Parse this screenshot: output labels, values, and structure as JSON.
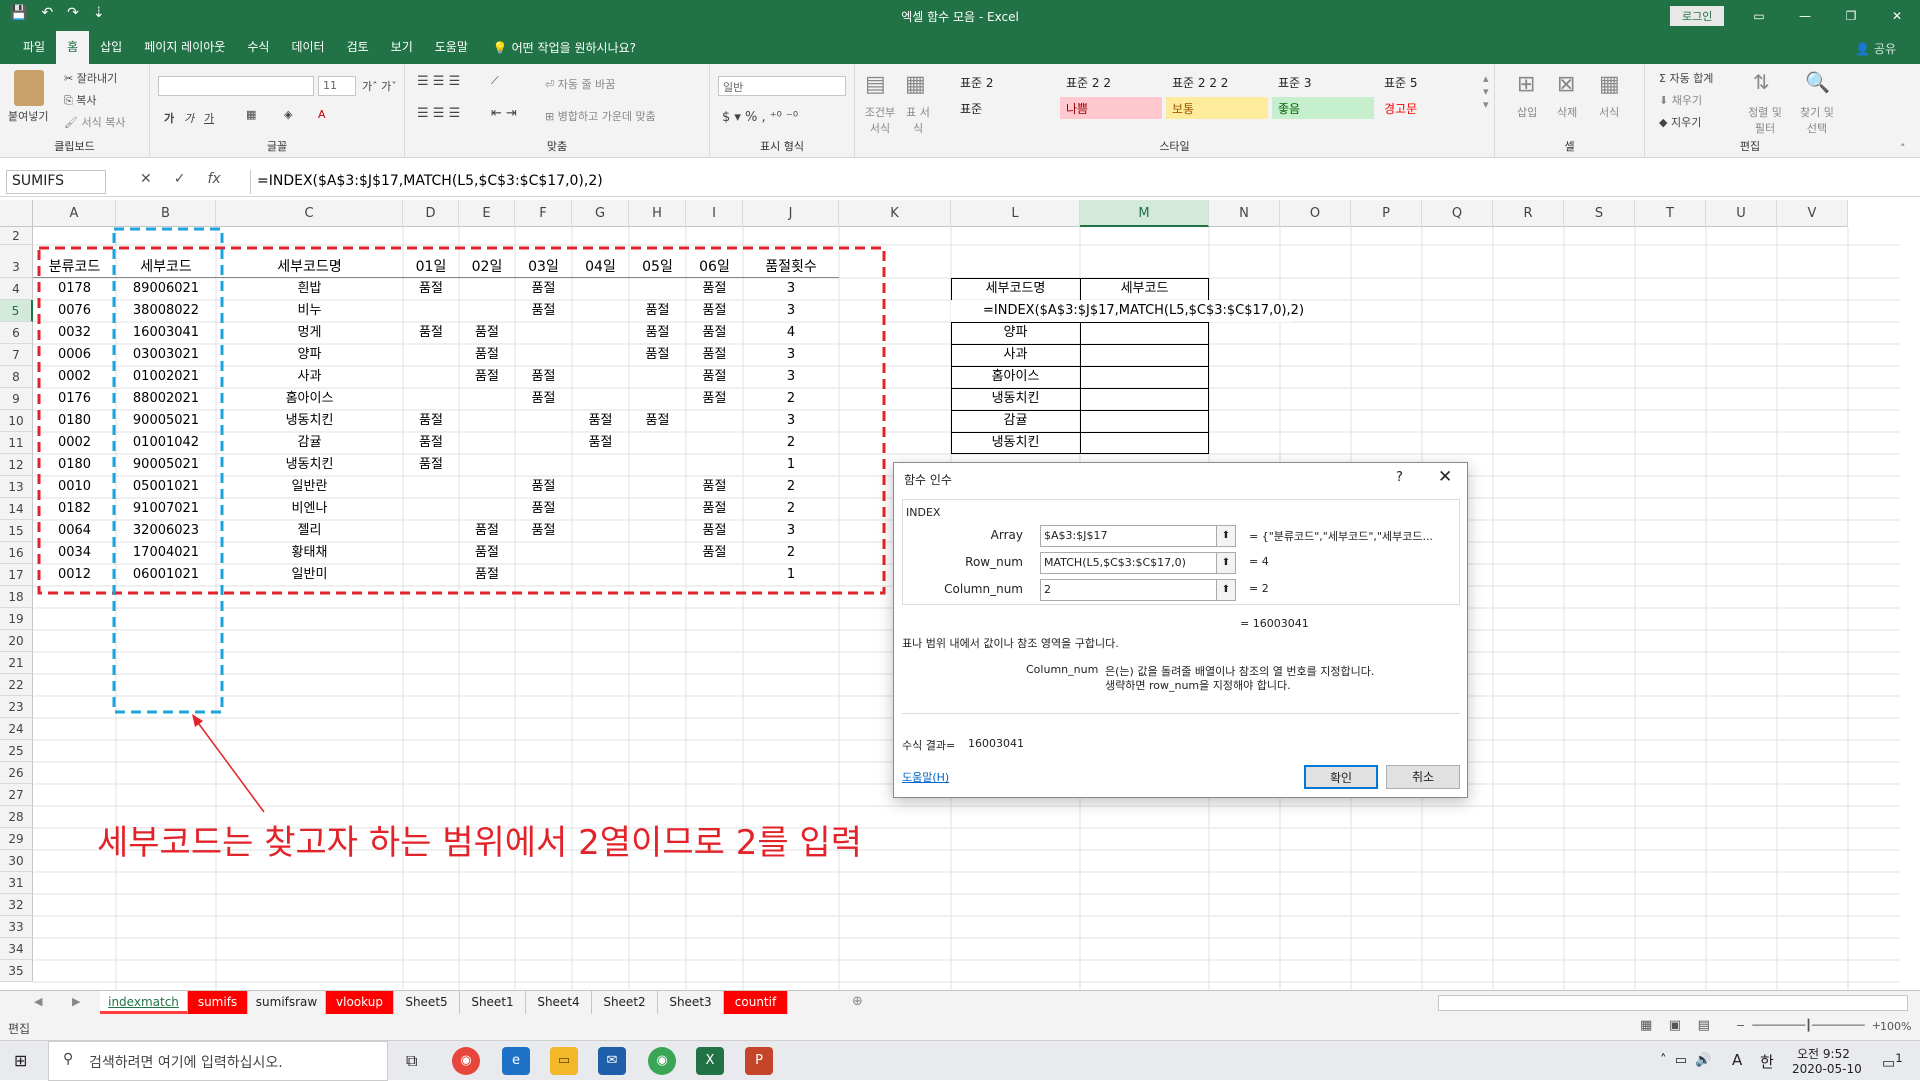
{
  "window": {
    "title": "엑셀 함수 모음  -  Excel",
    "login": "로그인",
    "qat": [
      "💾",
      "↶",
      "↷",
      "⇣"
    ]
  },
  "menu": {
    "tabs": [
      "파일",
      "홈",
      "삽입",
      "페이지 레이아웃",
      "수식",
      "데이터",
      "검토",
      "보기",
      "도움말"
    ],
    "search": "어떤 작업을 원하시나요?",
    "share": "공유"
  },
  "ribbon": {
    "clipboard": {
      "label": "클립보드",
      "paste": "붙여넣기",
      "cut": "잘라내기",
      "copy": "복사",
      "format_painter": "서식 복사"
    },
    "font": {
      "label": "글꼴",
      "size": "11",
      "bold": "가",
      "italic": "가",
      "underline": "가"
    },
    "align": {
      "label": "맞춤",
      "wrap": "자동 줄 바꿈",
      "merge": "병합하고 가운데 맞춤"
    },
    "number": {
      "label": "표시 형식",
      "format": "일반"
    },
    "styles": {
      "label": "스타일",
      "cond": "조건부 서식",
      "table": "표 서식",
      "cells": [
        {
          "text": "표준 2",
          "bg": "#ffffff",
          "color": "#222"
        },
        {
          "text": "표준 2 2",
          "bg": "#ffffff",
          "color": "#222"
        },
        {
          "text": "표준 2 2 2",
          "bg": "#ffffff",
          "color": "#222"
        },
        {
          "text": "표준 3",
          "bg": "#ffffff",
          "color": "#222"
        },
        {
          "text": "표준 5",
          "bg": "#ffffff",
          "color": "#222"
        },
        {
          "text": "표준",
          "bg": "#ffffff",
          "color": "#222"
        },
        {
          "text": "나쁨",
          "bg": "#ffc7ce",
          "color": "#9c0006"
        },
        {
          "text": "보통",
          "bg": "#ffeb9c",
          "color": "#9c5700"
        },
        {
          "text": "좋음",
          "bg": "#c6efce",
          "color": "#006100"
        },
        {
          "text": "경고문",
          "bg": "#ffffff",
          "color": "#ff0000"
        }
      ]
    },
    "cells": {
      "label": "셀",
      "insert": "삽입",
      "delete": "삭제",
      "format": "서식"
    },
    "editing": {
      "label": "편집",
      "autosum": "자동 합계",
      "fill": "채우기",
      "clear": "지우기",
      "sort": "정렬 및 필터",
      "find": "찾기 및 선택"
    }
  },
  "formula_bar": {
    "name_box": "SUMIFS",
    "formula": "=INDEX($A$3:$J$17,MATCH(L5,$C$3:$C$17,0),2)"
  },
  "columns": [
    "A",
    "B",
    "C",
    "D",
    "E",
    "F",
    "G",
    "H",
    "I",
    "J",
    "K",
    "L",
    "M",
    "N",
    "O",
    "P",
    "Q",
    "R",
    "S",
    "T",
    "U",
    "V"
  ],
  "rows": [
    "2",
    "3",
    "4",
    "5",
    "6",
    "7",
    "8",
    "9",
    "10",
    "11",
    "12",
    "13",
    "14",
    "15",
    "16",
    "17",
    "18",
    "19",
    "20",
    "21",
    "22",
    "23",
    "24",
    "25",
    "26",
    "27",
    "28",
    "29",
    "30",
    "31",
    "32",
    "33",
    "34",
    "35"
  ],
  "table": {
    "headers": [
      "분류코드",
      "세부코드",
      "세부코드명",
      "01일",
      "02일",
      "03일",
      "04일",
      "05일",
      "06일",
      "품절횟수"
    ],
    "data": [
      [
        "0178",
        "89006021",
        "흰밥",
        "품절",
        "",
        "품절",
        "",
        "",
        "품절",
        "3"
      ],
      [
        "0076",
        "38008022",
        "비누",
        "",
        "",
        "품절",
        "",
        "품절",
        "품절",
        "3"
      ],
      [
        "0032",
        "16003041",
        "멍게",
        "품절",
        "품절",
        "",
        "",
        "품절",
        "품절",
        "4"
      ],
      [
        "0006",
        "03003021",
        "양파",
        "",
        "품절",
        "",
        "",
        "품절",
        "품절",
        "3"
      ],
      [
        "0002",
        "01002021",
        "사과",
        "",
        "품절",
        "품절",
        "",
        "",
        "품절",
        "3"
      ],
      [
        "0176",
        "88002021",
        "홈아이스",
        "",
        "",
        "품절",
        "",
        "",
        "품절",
        "2"
      ],
      [
        "0180",
        "90005021",
        "냉동치킨",
        "품절",
        "",
        "",
        "품절",
        "품절",
        "",
        "3"
      ],
      [
        "0002",
        "01001042",
        "감귤",
        "품절",
        "",
        "",
        "품절",
        "",
        "",
        "2"
      ],
      [
        "0180",
        "90005021",
        "냉동치킨",
        "품절",
        "",
        "",
        "",
        "",
        "",
        "1"
      ],
      [
        "0010",
        "05001021",
        "일반란",
        "",
        "",
        "품절",
        "",
        "",
        "품절",
        "2"
      ],
      [
        "0182",
        "91007021",
        "비엔나",
        "",
        "",
        "품절",
        "",
        "",
        "품절",
        "2"
      ],
      [
        "0064",
        "32006023",
        "젤리",
        "",
        "품절",
        "품절",
        "",
        "",
        "품절",
        "3"
      ],
      [
        "0034",
        "17004021",
        "황태채",
        "",
        "품절",
        "",
        "",
        "",
        "품절",
        "2"
      ],
      [
        "0012",
        "06001021",
        "일반미",
        "",
        "품절",
        "",
        "",
        "",
        "",
        "1"
      ]
    ]
  },
  "lookup": {
    "headers": [
      "세부코드명",
      "세부코드"
    ],
    "editing_formula": "=INDEX($A$3:$J$17,MATCH(L5,$C$3:$C$17,0),2)",
    "names": [
      "양파",
      "사과",
      "홈아이스",
      "냉동치킨",
      "감귤",
      "냉동치킨"
    ]
  },
  "annotation": "세부코드는 찾고자 하는 범위에서 2열이므로 2를 입력",
  "dialog": {
    "title": "함수 인수",
    "help_q": "?",
    "close": "✕",
    "function": "INDEX",
    "args": [
      {
        "label": "Array",
        "value": "$A$3:$J$17",
        "result": "=  {\"분류코드\",\"세부코드\",\"세부코드..."
      },
      {
        "label": "Row_num",
        "value": "MATCH(L5,$C$3:$C$17,0)",
        "result": "=  4"
      },
      {
        "label": "Column_num",
        "value": "2",
        "result": "=  2"
      }
    ],
    "total": "=  16003041",
    "desc": "표나 범위 내에서 값이나 참조 영역을 구합니다.",
    "arg_name": "Column_num",
    "arg_desc1": "은(는) 값을 돌려줄 배열이나 참조의 열 번호를 지정합니다.",
    "arg_desc2": "생략하면 row_num을 지정해야 합니다.",
    "result_label": "수식 결과=",
    "result_value": "16003041",
    "help": "도움말(H)",
    "ok": "확인",
    "cancel": "취소"
  },
  "sheets": [
    {
      "name": "indexmatch",
      "style": "active"
    },
    {
      "name": "sumifs",
      "style": "red"
    },
    {
      "name": "sumifsraw",
      "style": "normal"
    },
    {
      "name": "vlookup",
      "style": "red"
    },
    {
      "name": "Sheet5",
      "style": "normal"
    },
    {
      "name": "Sheet1",
      "style": "normal"
    },
    {
      "name": "Sheet4",
      "style": "normal"
    },
    {
      "name": "Sheet2",
      "style": "normal"
    },
    {
      "name": "Sheet3",
      "style": "normal"
    },
    {
      "name": "countif",
      "style": "red"
    }
  ],
  "status": {
    "mode": "편집",
    "zoom": "100%"
  },
  "taskbar": {
    "search": "검색하려면 여기에 입력하십시오.",
    "time": "오전 9:52",
    "date": "2020-05-10",
    "ime": "A",
    "lang": "한",
    "notif": "1"
  },
  "colors": {
    "excel_green": "#217346",
    "annot_red": "#e3232a",
    "red_dash": "#e3232a",
    "blue_dash": "#1aa3dc",
    "tab_red": "#ff0000"
  }
}
